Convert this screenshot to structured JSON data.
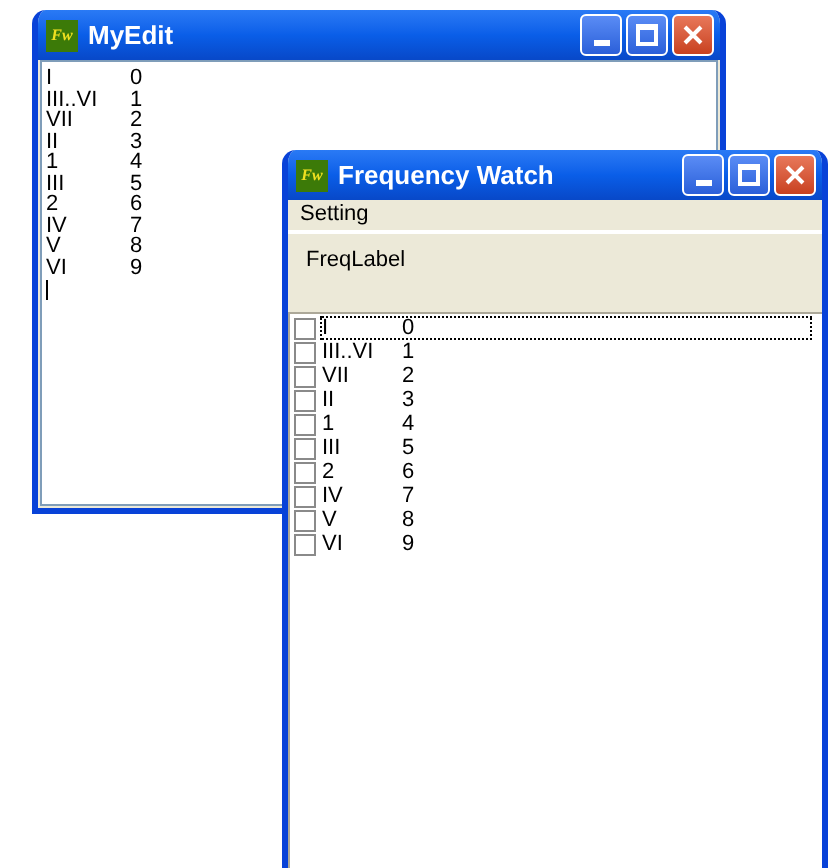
{
  "windows": [
    {
      "kind": "editor",
      "title": "MyEdit",
      "icon_label": "Fw",
      "lines": [
        {
          "name": "I",
          "value": "0"
        },
        {
          "name": "III..VI",
          "value": "1"
        },
        {
          "name": "VII",
          "value": "2"
        },
        {
          "name": "II",
          "value": "3"
        },
        {
          "name": "1",
          "value": "4"
        },
        {
          "name": "III",
          "value": "5"
        },
        {
          "name": "2",
          "value": "6"
        },
        {
          "name": "IV",
          "value": "7"
        },
        {
          "name": "V",
          "value": "8"
        },
        {
          "name": "VI",
          "value": "9"
        }
      ]
    },
    {
      "kind": "checklist",
      "title": "Frequency Watch",
      "icon_label": "Fw",
      "menu": [
        "Setting"
      ],
      "label": "FreqLabel",
      "items": [
        {
          "name": "I",
          "value": "0",
          "checked": false,
          "focused": true
        },
        {
          "name": "III..VI",
          "value": "1",
          "checked": false,
          "focused": false
        },
        {
          "name": "VII",
          "value": "2",
          "checked": false,
          "focused": false
        },
        {
          "name": "II",
          "value": "3",
          "checked": false,
          "focused": false
        },
        {
          "name": "1",
          "value": "4",
          "checked": false,
          "focused": false
        },
        {
          "name": "III",
          "value": "5",
          "checked": false,
          "focused": false
        },
        {
          "name": "2",
          "value": "6",
          "checked": false,
          "focused": false
        },
        {
          "name": "IV",
          "value": "7",
          "checked": false,
          "focused": false
        },
        {
          "name": "V",
          "value": "8",
          "checked": false,
          "focused": false
        },
        {
          "name": "VI",
          "value": "9",
          "checked": false,
          "focused": false
        }
      ]
    }
  ]
}
